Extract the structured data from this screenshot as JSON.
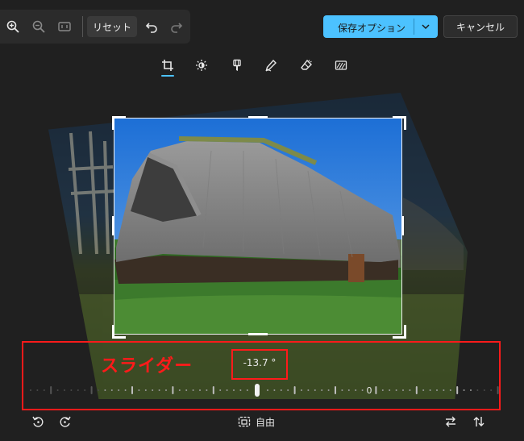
{
  "toolbar": {
    "zoom_in_icon": "zoom-in-icon",
    "zoom_out_icon": "zoom-out-icon",
    "fit_icon": "fit-view-icon",
    "reset_label": "リセット",
    "undo_icon": "undo-icon",
    "redo_icon": "redo-icon",
    "save_label": "保存オプション",
    "cancel_label": "キャンセル"
  },
  "tools": [
    {
      "name": "crop",
      "icon": "crop-icon",
      "active": true
    },
    {
      "name": "adjust",
      "icon": "brightness-icon",
      "active": false
    },
    {
      "name": "filter",
      "icon": "filter-icon",
      "active": false
    },
    {
      "name": "markup",
      "icon": "pen-icon",
      "active": false
    },
    {
      "name": "erase",
      "icon": "eraser-icon",
      "active": false
    },
    {
      "name": "background",
      "icon": "background-icon",
      "active": false
    }
  ],
  "annotation": {
    "label": "スライダー"
  },
  "straighten": {
    "angle_text": "-13.7 °",
    "angle_value": -13.7,
    "zero_label": "0",
    "min": -45,
    "max": 45
  },
  "bottom": {
    "rotate_left_icon": "rotate-left-icon",
    "rotate_right_icon": "rotate-right-icon",
    "aspect_label": "自由",
    "flip_h_icon": "flip-horizontal-icon",
    "flip_v_icon": "flip-vertical-icon"
  },
  "colors": {
    "accent": "#4cc2ff",
    "annotation": "#ff1a1a",
    "background": "#202020"
  }
}
